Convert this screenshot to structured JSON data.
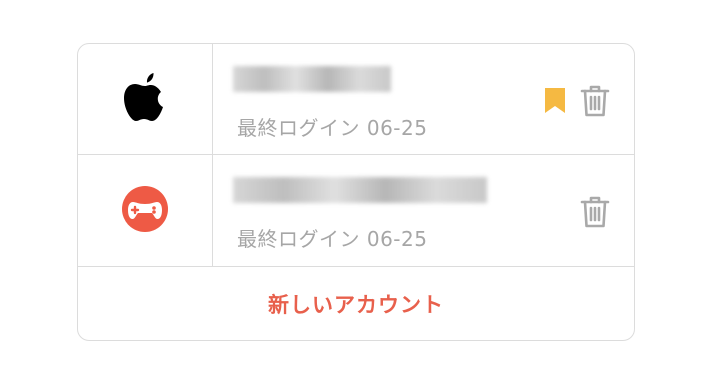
{
  "accounts": [
    {
      "provider_icon": "apple-logo-icon",
      "name": "xxxxxxxx",
      "last_login_label": "最終ログイン 06-25",
      "bookmarked": true,
      "bookmark_color": "#f5b942"
    },
    {
      "provider_icon": "gamepad-logo-icon",
      "name": "xxxxxxxxxxxxxx",
      "last_login_label": "最終ログイン 06-25",
      "bookmarked": false,
      "provider_color": "#ee5a45"
    }
  ],
  "new_account_label": "新しいアカウント",
  "colors": {
    "accent": "#e8604c",
    "muted_text": "#a6a6a6",
    "icon_gray": "#a9a9a9",
    "divider": "#dcdcdc"
  }
}
